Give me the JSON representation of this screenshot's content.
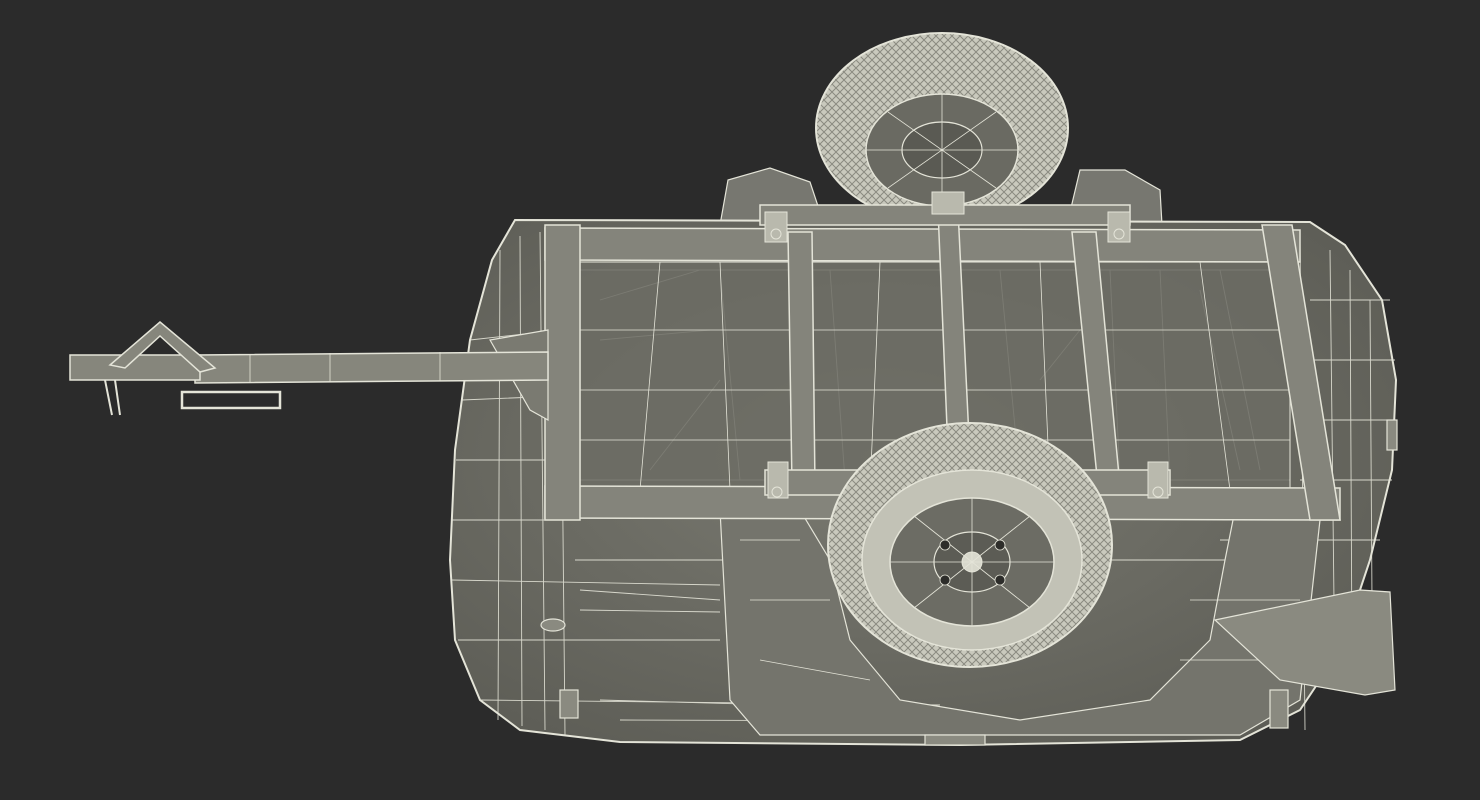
{
  "scene": {
    "subject": "trailer-wireframe-render",
    "colors": {
      "background": "#2b2b2b",
      "surface": "#6f6f66",
      "surface_light": "#86867c",
      "surface_dark": "#55554e",
      "wire": "#e4e4d8",
      "tire": "#c9c9bd"
    }
  }
}
